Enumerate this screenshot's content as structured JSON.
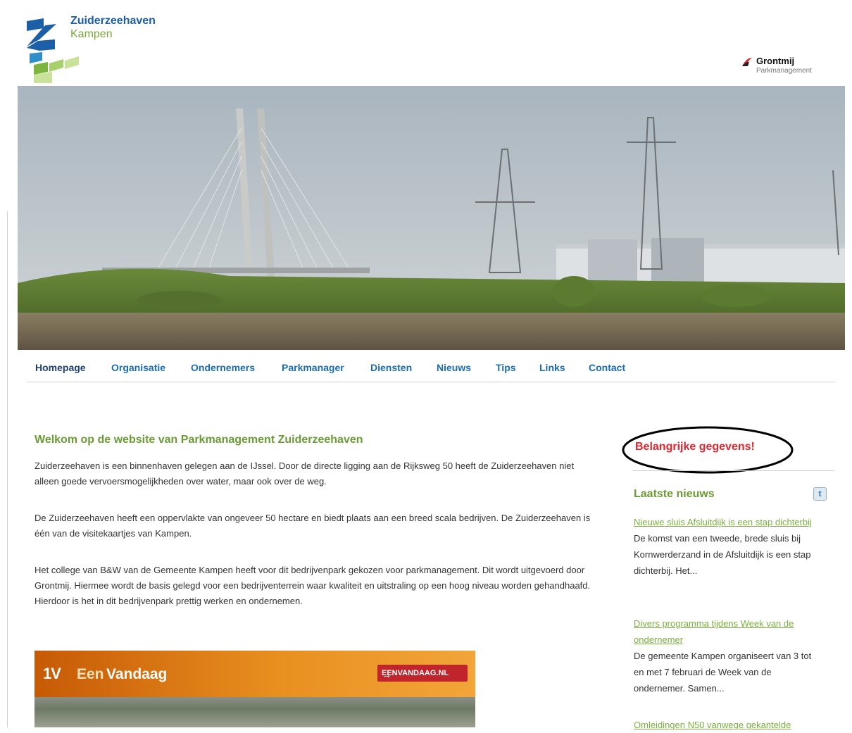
{
  "logo": {
    "title": "Zuiderzeehaven",
    "subtitle": "Kampen"
  },
  "partner": {
    "name": "Grontmij",
    "sub": "Parkmanagement"
  },
  "nav": [
    "Homepage",
    "Organisatie",
    "Ondernemers",
    "Parkmanager",
    "Diensten",
    "Nieuws",
    "Tips",
    "Links",
    "Contact"
  ],
  "main": {
    "title": "Welkom op de website van Parkmanagement Zuiderzeehaven",
    "paragraphs": [
      "Zuiderzeehaven is een binnenhaven gelegen aan de IJssel. Door de directe ligging aan de Rijksweg 50 heeft de Zuiderzeehaven niet alleen goede vervoersmogelijkheden over water, maar ook over de weg.",
      "De Zuiderzeehaven heeft een oppervlakte van ongeveer 50 hectare en biedt plaats aan een breed scala bedrijven. De Zuiderzeehaven is één van de visitekaartjes van Kampen.",
      "Het college van B&W van de Gemeente Kampen heeft voor dit bedrijvenpark gekozen voor parkmanagement. Dit wordt uitgevoerd door Grontmij. Hiermee wordt de basis gelegd voor een bedrijventerrein waar kwaliteit en uitstraling op een hoog niveau worden gehandhaafd. Hierdoor is het in dit bedrijvenpark prettig werken en ondernemen."
    ]
  },
  "video": {
    "badge": "1V",
    "brand_a": "Een",
    "brand_b": "Vandaag",
    "link": "EENVANDAAG.NL"
  },
  "sidebar": {
    "important": "Belangrijke gegevens!",
    "news_title": "Laatste nieuws",
    "news": [
      {
        "title": "Nieuwe sluis Afsluitdijk is een stap dichterbij",
        "text": "De komst van een tweede, brede sluis bij Kornwerderzand in de Afsluitdijk is een stap dichterbij. Het..."
      },
      {
        "title": "Divers programma tijdens Week van de ondernemer",
        "text": "De gemeente Kampen organiseert van 3 tot en met 7 februari de Week van de ondernemer. Samen..."
      },
      {
        "title": "Omleidingen N50 vanwege gekantelde",
        "text": ""
      }
    ]
  },
  "colors": {
    "brand_blue": "#1c5fa6",
    "brand_green": "#6b9b34",
    "alert_red": "#e0262e",
    "link_green": "#7ab03d"
  }
}
